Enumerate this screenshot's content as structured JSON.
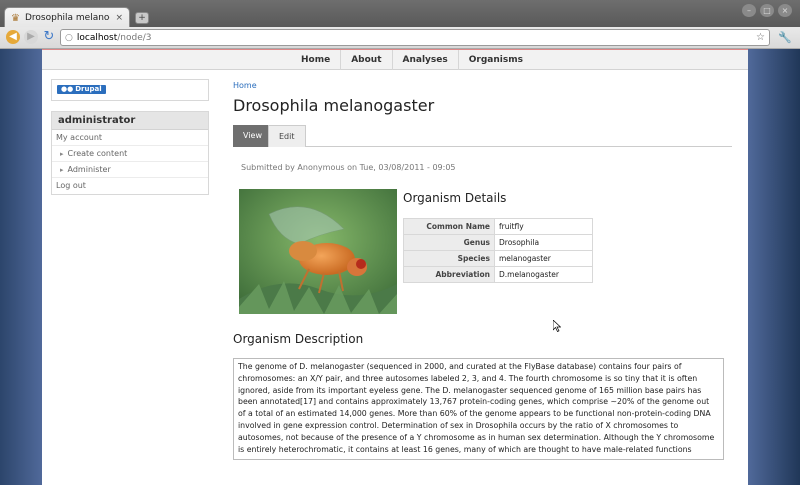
{
  "browser": {
    "tab_title": "Drosophila melanoga…",
    "url_host": "localhost",
    "url_path": "/node/3",
    "new_tab_label": "+",
    "close_label": "×"
  },
  "nav": {
    "items": [
      "Home",
      "About",
      "Analyses",
      "Organisms"
    ]
  },
  "sidebar": {
    "logo_text": "Drupal",
    "user_block_title": "administrator",
    "items": [
      "My account",
      "Create content",
      "Administer",
      "Log out"
    ]
  },
  "content": {
    "breadcrumb": "Home",
    "title": "Drosophila melanogaster",
    "tabs": [
      "View",
      "Edit"
    ],
    "submitted": "Submitted by Anonymous on Tue, 03/08/2011 - 09:05",
    "details_title": "Organism Details",
    "details": [
      {
        "label": "Common Name",
        "value": "fruitfly"
      },
      {
        "label": "Genus",
        "value": "Drosophila"
      },
      {
        "label": "Species",
        "value": "melanogaster"
      },
      {
        "label": "Abbreviation",
        "value": "D.melanogaster"
      }
    ],
    "description_title": "Organism Description",
    "description": "The genome of D. melanogaster (sequenced in 2000, and curated at the FlyBase database) contains four pairs of chromosomes: an X/Y pair, and three autosomes labeled 2, 3, and 4. The fourth chromosome is so tiny that it is often ignored, aside from its important eyeless gene. The D. melanogaster sequenced genome of 165 million base pairs has been annotated[17] and contains approximately 13,767 protein-coding genes, which comprise ~20% of the genome out of a total of an estimated 14,000 genes. More than 60% of the genome appears to be functional non-protein-coding DNA involved in gene expression control. Determination of sex in Drosophila occurs by the ratio of X chromosomes to autosomes, not because of the presence of a Y chromosome as in human sex determination. Although the Y chromosome is entirely heterochromatic, it contains at least 16 genes, many of which are thought to have male-related functions"
  },
  "colors": {
    "link": "#2b6ebd",
    "tab_active_bg": "#6f6f6f",
    "desktop_bg": "#3f5a86"
  }
}
